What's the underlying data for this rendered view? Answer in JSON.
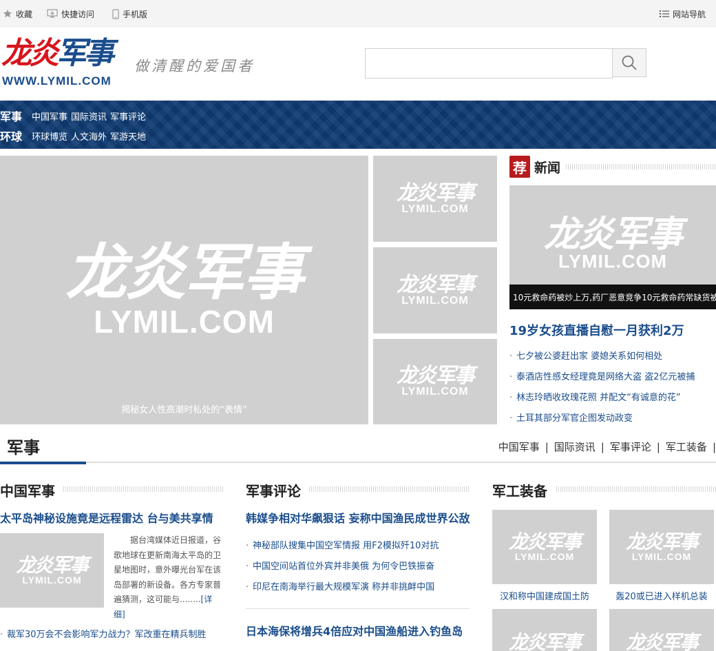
{
  "topbar": {
    "favorite": "收藏",
    "quick_access": "快捷访问",
    "mobile": "手机版",
    "site_nav": "网站导航"
  },
  "header": {
    "logo_red": "龙炎",
    "logo_blue": "军事",
    "logo_url": "WWW.LYMIL.COM",
    "slogan": "做清醒的爱国者",
    "search_placeholder": ""
  },
  "nav": {
    "rows": [
      {
        "category": "军事",
        "links": [
          "中国军事",
          "国际资讯",
          "军事评论"
        ]
      },
      {
        "category": "环球",
        "links": [
          "环球博览",
          "人文海外",
          "军游天地"
        ]
      }
    ]
  },
  "watermark": {
    "cn": "龙炎军事",
    "en": "LYMIL.COM"
  },
  "feature": {
    "main_caption": "揭秘女人性高潮时私处的“表情”"
  },
  "news": {
    "badge": "荐",
    "title": "新闻",
    "image_caption": "10元救命药被炒上万,药厂恶意竞争10元救命药常缺货被",
    "headline": "19岁女孩直播自慰一月获利2万",
    "items": [
      "七夕被公婆赶出家 婆媳关系如何相处",
      "泰酒店性感女经理竟是网络大盗 盗2亿元被捕",
      "林志玲晒收玫瑰花照 并配文“有诚意的花”",
      "土耳其部分军官企图发动政变"
    ]
  },
  "section": {
    "title": "军事",
    "links": [
      "中国军事",
      "国际资讯",
      "军事评论",
      "军工装备"
    ],
    "separator": "|"
  },
  "col1": {
    "title": "中国军事",
    "headline": "太平岛神秘设施竟是远程雷达 台与美共享情",
    "summary": "据台湾媒体近日报道，谷歌地球在更新南海太平岛的卫星地图时，意外曝光台军在该岛部署的新设备。各方专家普遍猜测，这可能与........",
    "more": "[详细]",
    "item": "裁军30万会不会影响军力战力？军改重在精兵制胜"
  },
  "col2": {
    "title": "军事评论",
    "headline": "韩媒争相对华飙狠话 妄称中国渔民成世界公敌",
    "items": [
      "神秘部队搜集中国空军情报 用F2模拟歼10对抗",
      "中国空间站首位外宾并非美俄 为何令巴铁振奋",
      "印尼在南海举行最大规模军演 称并非挑衅中国"
    ],
    "headline2": "日本海保将增兵4倍应对中国渔船进入钓鱼岛"
  },
  "col3": {
    "title": "军工装备",
    "captions": [
      "汉和称中国建成国土防",
      "轰20或已进入样机总装"
    ]
  },
  "colors": {
    "brand_blue": "#1a4d8c",
    "brand_red": "#d8141c",
    "nav_bg": "#0f3b73",
    "placeholder": "#d0d0d0"
  }
}
